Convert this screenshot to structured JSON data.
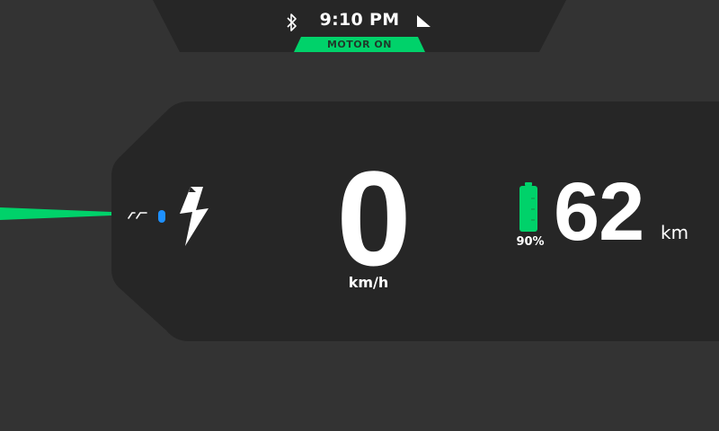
{
  "status_bar": {
    "time": "9:10 PM",
    "bluetooth_icon": "bluetooth-icon",
    "signal_icon": "signal-icon"
  },
  "motor_status": {
    "label": "MOTOR ON",
    "color": "#00d26a"
  },
  "riding_mode": {
    "mode_icon": "ride-mode-icon",
    "indicator_color": "#1e90ff",
    "charge_icon": "lightning-bolt-icon"
  },
  "speed": {
    "value": "0",
    "unit": "km/h"
  },
  "battery": {
    "level_percent": 90,
    "label": "90%",
    "color": "#00d26a",
    "icon": "battery-icon"
  },
  "range": {
    "value": "62",
    "unit": "km"
  },
  "colors": {
    "background": "#333333",
    "panel": "#262626",
    "accent": "#00d26a",
    "text": "#ffffff"
  }
}
